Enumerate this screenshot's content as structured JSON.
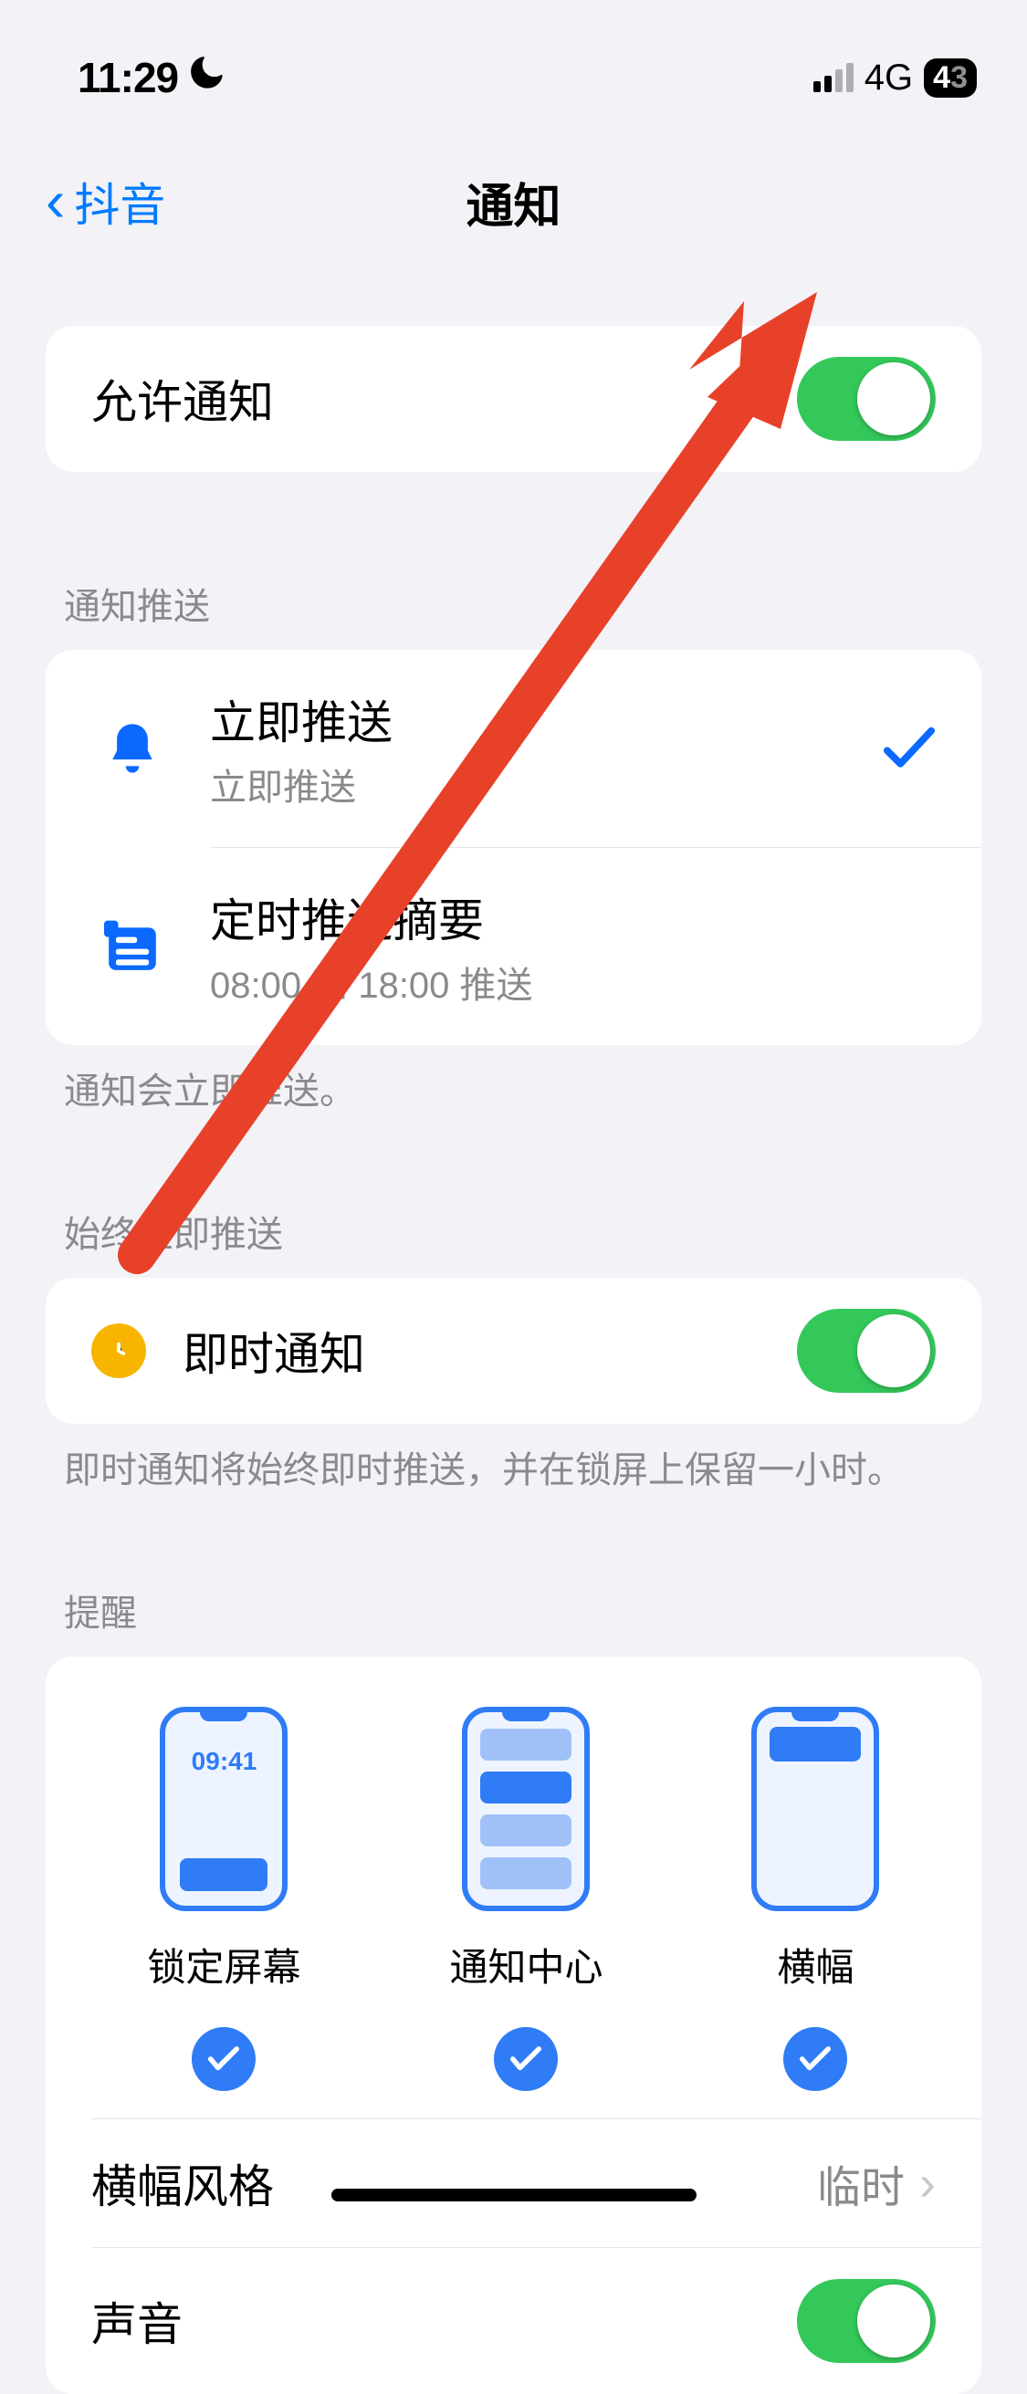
{
  "status": {
    "time": "11:29",
    "network": "4G",
    "battery": "43"
  },
  "nav": {
    "back": "抖音",
    "title": "通知"
  },
  "allow_notifications": {
    "label": "允许通知"
  },
  "delivery": {
    "header": "通知推送",
    "immediate": {
      "title": "立即推送",
      "sub": "立即推送"
    },
    "scheduled": {
      "title": "定时推送摘要",
      "sub": "08:00 和 18:00 推送"
    },
    "footer": "通知会立即推送。"
  },
  "always_immediate": {
    "header": "始终立即推送",
    "time_sensitive": "即时通知",
    "footer": "即时通知将始终即时推送，并在锁屏上保留一小时。"
  },
  "alerts": {
    "header": "提醒",
    "lock_screen": {
      "label": "锁定屏幕",
      "preview_time": "09:41"
    },
    "notification_center": {
      "label": "通知中心"
    },
    "banners": {
      "label": "横幅"
    },
    "banner_style": {
      "label": "横幅风格",
      "value": "临时"
    },
    "sound": {
      "label": "声音"
    }
  }
}
